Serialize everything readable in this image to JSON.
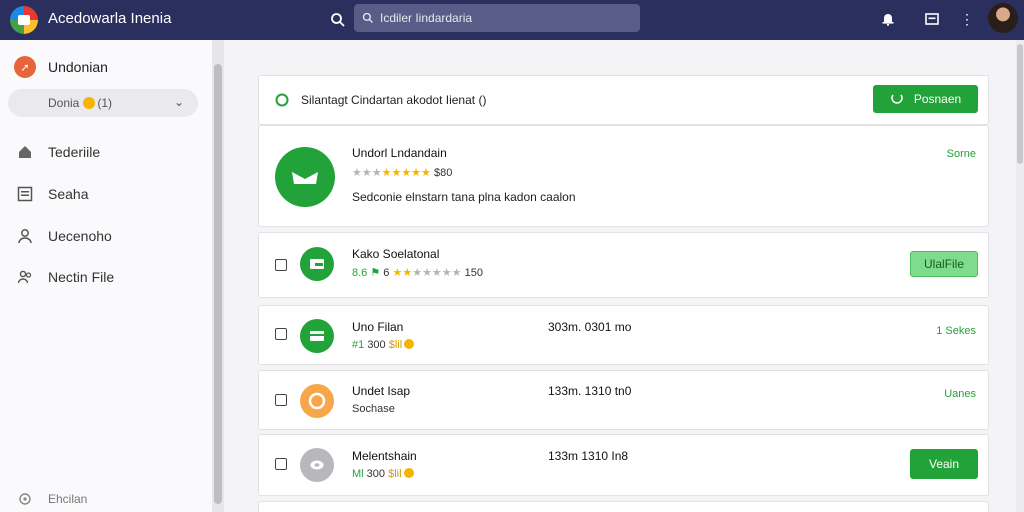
{
  "app": {
    "title": "Acedowarla Inenia",
    "search_value": "Icdiler Iindardaria",
    "colors": {
      "topbar": "#2b2f5e",
      "accent_green": "#22a33a",
      "sidebar": "#fafafc"
    }
  },
  "sidebar": {
    "brand_label": "Undonian",
    "dropdown_value": "Donia",
    "dropdown_badge": "(1)",
    "items": [
      {
        "label": "Tederiile",
        "icon": "home-icon"
      },
      {
        "label": "Seaha",
        "icon": "list-icon"
      },
      {
        "label": "Uecenoho",
        "icon": "user-icon"
      },
      {
        "label": "Nectin File",
        "icon": "people-icon"
      }
    ],
    "footer_label": "Ehcilan"
  },
  "banner": {
    "text": "Silantagt Cindartan akodot Iienat ()",
    "button_label": "Posnaen"
  },
  "featured": {
    "title": "Undorl Lndandain",
    "rating_value": "$80",
    "description": "Sedconie elnstarn tana plna kadon caalon",
    "status": "Sorne"
  },
  "rows": [
    {
      "name": "Kako Soelatonal",
      "sub_prefix": "8.6",
      "sub_mid": "6",
      "sub_value": "150",
      "stars_on": 2,
      "stars_off": 5,
      "button_label": "UlalFile",
      "button_style": "light"
    },
    {
      "name": "Uno Filan",
      "sub_prefix": "#1",
      "sub_value": "300",
      "sub_currency": "$lil",
      "time": "303m. 0301 mo",
      "right_label": "1 Sekes"
    },
    {
      "name": "Undet Isap",
      "sub_text": "Sochase",
      "time": "133m. 1310 tn0",
      "right_label": "Uanes"
    },
    {
      "name": "Melentshain",
      "sub_prefix": "Ml",
      "sub_value": "300",
      "sub_currency": "$lil",
      "time": "133m 1310 In8",
      "button_label": "Veain",
      "button_style": "solid"
    }
  ]
}
